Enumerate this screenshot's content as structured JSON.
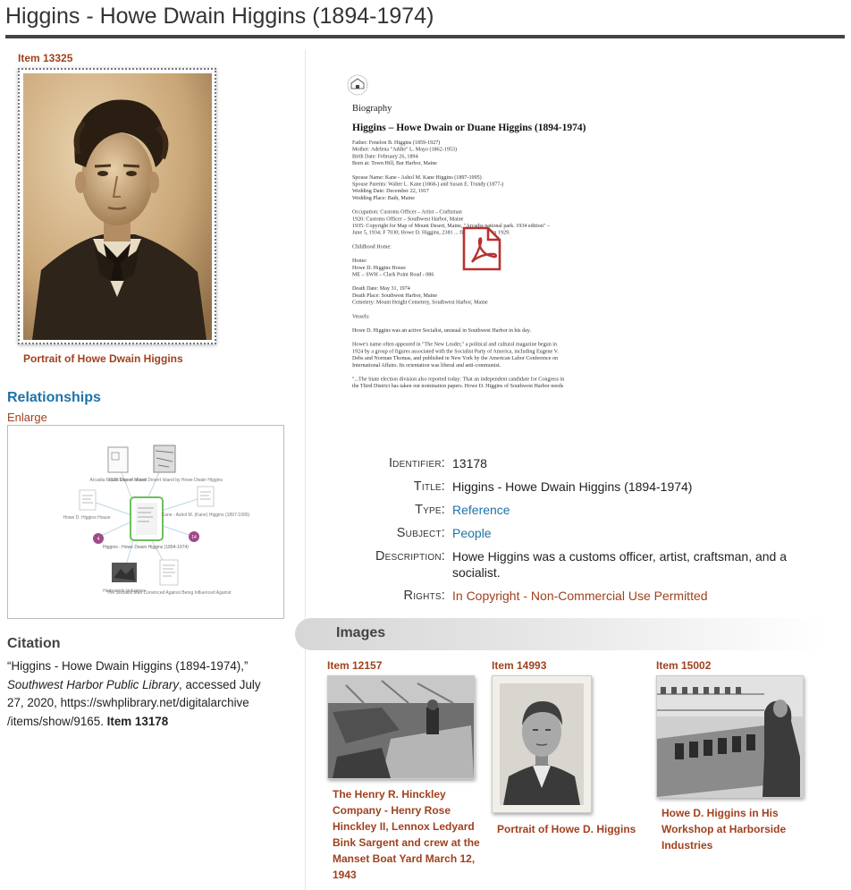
{
  "page": {
    "title": "Higgins - Howe Dwain Higgins (1894-1974)"
  },
  "main_item": {
    "label": "Item 13325",
    "caption": "Portrait of Howe Dwain Higgins"
  },
  "document_preview": {
    "heading": "Biography",
    "title": "Higgins – Howe Dwain or Duane Higgins (1894-1974)",
    "lines_block1": [
      "Father: Fenelon B. Higgins (1859-1927)",
      "Mother: Adelena \"Addie\" L. Mayo (1862-1953)",
      "Birth Date: February 26, 1894",
      "Born at: Town Hill, Bar Harbor, Maine"
    ],
    "lines_block2": [
      "Spouse Name: Kane - Ashol M. Kane Higgins (1897-1995)",
      "Spouse Parents: Walter L. Kane (1868-) and Susan E. Trundy (1877-)",
      "Wedding Date: December 22, 1917",
      "Wedding Place: Bath, Maine"
    ],
    "lines_block3": [
      "Occupation: Customs Officer – Artist – Craftsman",
      "1920: Customs Officer – Southwest Harbor, Maine",
      "1935: Copyright for Map of Mount Desert, Maine, \"Arcadia national park. 1934 edition\" –",
      "June 5, 1934; F 7030; Howe D. Higgins, 2381 ... first published in 1929."
    ],
    "lines_block4": [
      "Childhood Home:"
    ],
    "lines_block5": [
      "Home:",
      "Howe D. Higgins House",
      "ME – SWH – Clark Point Road - 086"
    ],
    "lines_block6": [
      "Death Date: May 31, 1974",
      "Death Place: Southwest Harbor, Maine",
      "Cemetery: Mount Height Cemetery, Southwest Harbor, Maine"
    ],
    "lines_block7": [
      "Vessels:"
    ],
    "lines_block8": [
      "Howe D. Higgins was an active Socialist, unusual in Southwest Harbor in his day."
    ],
    "lines_block9": [
      "Howe's name often appeared in \"The New Leader,\" a political and cultural magazine begun in",
      "1924 by a group of figures associated with the Socialist Party of America, including Eugene V.",
      "Debs and Norman Thomas, and published in New York by the American Labor Conference on",
      "International Affairs. Its orientation was liberal and anti-communist."
    ],
    "lines_block10": [
      "\"...The State election division also reported today: That an independent candidate for Congress in",
      "the Third District has taken out nomination papers. Howe D. Higgins of Southwest Harbor needs"
    ]
  },
  "relationships": {
    "heading": "Relationships",
    "enlarge_label": "Enlarge",
    "nodes": {
      "center": "Higgins - Howe Dwain Higgins (1894-1974)",
      "top_left": "Arcadia Mount Desert Island",
      "top_right": "1935 Map of Mount Desert Island by Howe Dwain Higgins",
      "left": "Howe D. Higgins House",
      "right": "Kane - Ashol M. (Kane) Higgins (1897-1995)",
      "bottom_left": "Harborside Industries",
      "bottom_right": "The Socialist Man Convinced Against Being Influenced Against"
    },
    "badges": [
      "4",
      "14"
    ]
  },
  "citation": {
    "heading": "Citation",
    "text_quote": "“Higgins - Howe Dwain Higgins (1894-1974),”",
    "publisher": "Southwest Harbor Public Library",
    "accessed": ", accessed July 27, 2020, https://swhplibrary.net/digitalarchive /items/show/9165.",
    "item": "Item 13178"
  },
  "metadata": {
    "identifier_label": "Identifier:",
    "identifier": "13178",
    "title_label": "Title:",
    "title": "Higgins - Howe Dwain Higgins (1894-1974)",
    "type_label": "Type:",
    "type": "Reference",
    "subject_label": "Subject:",
    "subject": "People",
    "description_label": "Description:",
    "description": "Howe Higgins was a customs officer, artist, craftsman, and a socialist.",
    "rights_label": "Rights:",
    "rights": "In Copyright - Non-Commercial Use Permitted"
  },
  "images_section": {
    "heading": "Images",
    "items": [
      {
        "label": "Item 12157",
        "caption": "The Henry R. Hinckley Company - Henry Rose Hinckley II, Lennox Ledyard Bink Sargent and crew at the Manset Boat Yard March 12, 1943"
      },
      {
        "label": "Item 14993",
        "caption": "Portrait of Howe D. Higgins"
      },
      {
        "label": "Item 15002",
        "caption": "Howe D. Higgins in His Workshop at Harborside Industries"
      }
    ]
  },
  "colors": {
    "link_rust": "#a0411e",
    "heading_blue": "#1d73a9",
    "title_rule": "#444444",
    "pdf_red": "#b8312f"
  }
}
